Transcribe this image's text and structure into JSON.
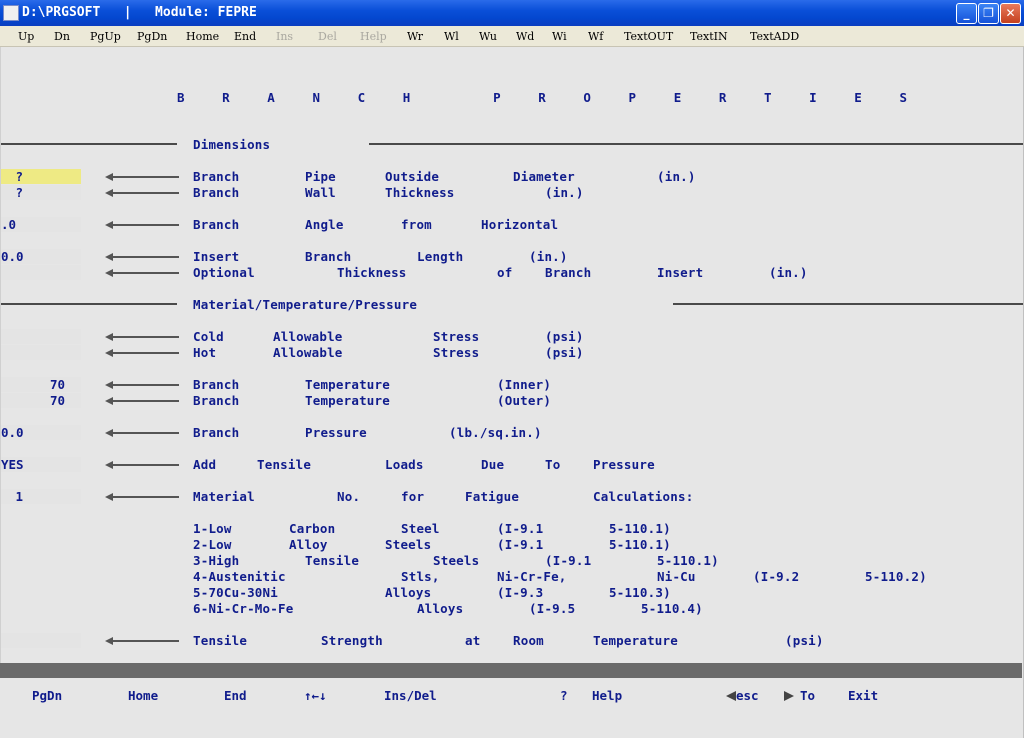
{
  "window": {
    "title": "D:\\PRGSOFT   |   Module: FEPRE",
    "buttons": {
      "minimize": "_",
      "maximize": "❐",
      "close": "✕"
    }
  },
  "menu": [
    {
      "label": "Up"
    },
    {
      "label": "Dn"
    },
    {
      "label": "PgUp"
    },
    {
      "label": "PgDn"
    },
    {
      "label": "Home"
    },
    {
      "label": "End"
    },
    {
      "label": "Ins"
    },
    {
      "label": "Del"
    },
    {
      "label": "Help"
    },
    {
      "label": "Wr"
    },
    {
      "label": "Wl"
    },
    {
      "label": "Wu"
    },
    {
      "label": "Wd"
    },
    {
      "label": "Wi"
    },
    {
      "label": "Wf"
    },
    {
      "label": "TextOUT"
    },
    {
      "label": "TextIN"
    },
    {
      "label": "TextADD"
    }
  ],
  "page": {
    "heading": "B     R     A     N     C     H           P     R     O     P     E     R     T     I     E     S",
    "section_dimensions": "Dimensions",
    "section_material": "Material/Temperature/Pressure",
    "row_pipe_od": {
      "value": "?",
      "c1": "Branch",
      "c2": "Pipe",
      "c3": "Outside",
      "c4": "Diameter",
      "c5": "(in.)"
    },
    "row_wall": {
      "value": "?",
      "c1": "Branch",
      "c2": "Wall",
      "c3": "Thickness",
      "c4": "(in.)"
    },
    "row_angle": {
      "value": ".0",
      "c1": "Branch",
      "c2": "Angle",
      "c3": "from",
      "c4": "Horizontal"
    },
    "row_insert_len": {
      "value": "0.0",
      "c1": "Insert",
      "c2": "Branch",
      "c3": "Length",
      "c4": "(in.)"
    },
    "row_insert_thk": {
      "value": "",
      "c1": "Optional",
      "c2": "Thickness",
      "c3": "of",
      "c4": "Branch",
      "c5": "Insert",
      "c6": "(in.)"
    },
    "row_cold": {
      "value": "",
      "c1": "Cold",
      "c2": "Allowable",
      "c3": "Stress",
      "c4": "(psi)"
    },
    "row_hot": {
      "value": "",
      "c1": "Hot",
      "c2": "Allowable",
      "c3": "Stress",
      "c4": "(psi)"
    },
    "row_temp_in": {
      "value": "70",
      "c1": "Branch",
      "c2": "Temperature",
      "c3": "(Inner)"
    },
    "row_temp_out": {
      "value": "70",
      "c1": "Branch",
      "c2": "Temperature",
      "c3": "(Outer)"
    },
    "row_pressure": {
      "value": "0.0",
      "c1": "Branch",
      "c2": "Pressure",
      "c3": "(lb./sq.in.)"
    },
    "row_tensile_add": {
      "value": "YES",
      "c1": "Add",
      "c2": "Tensile",
      "c3": "Loads",
      "c4": "Due",
      "c5": "To",
      "c6": "Pressure"
    },
    "row_material": {
      "value": "1",
      "c1": "Material",
      "c2": "No.",
      "c3": "for",
      "c4": "Fatigue",
      "c5": "Calculations:"
    },
    "materials": {
      "m1": {
        "a": "1-Low",
        "b": "Carbon",
        "c": "Steel",
        "d": "(I-9.1",
        "e": "5-110.1)"
      },
      "m2": {
        "a": "2-Low",
        "b": "Alloy",
        "c": "Steels",
        "d": "(I-9.1",
        "e": "5-110.1)"
      },
      "m3": {
        "a": "3-High",
        "b": "Tensile",
        "c": "Steels",
        "d": "(I-9.1",
        "e": "5-110.1)"
      },
      "m4": {
        "a": "4-Austenitic",
        "b": "Stls,",
        "c": "Ni-Cr-Fe,",
        "d": "Ni-Cu",
        "e": "(I-9.2",
        "f": "5-110.2)"
      },
      "m5": {
        "a": "5-70Cu-30Ni",
        "b": "Alloys",
        "c": "(I-9.3",
        "d": "5-110.3)"
      },
      "m6": {
        "a": "6-Ni-Cr-Mo-Fe",
        "b": "Alloys",
        "c": "(I-9.5",
        "d": "5-110.4)"
      }
    },
    "row_tensile_strength": {
      "value": "",
      "c1": "Tensile",
      "c2": "Strength",
      "c3": "at",
      "c4": "Room",
      "c5": "Temperature",
      "c6": "(psi)"
    }
  },
  "footer": {
    "pgdn": "PgDn",
    "home": "Home",
    "end": "End",
    "arrows": "↑←↓",
    "insdel": "Ins/Del",
    "q": "?",
    "help": "Help",
    "esc": "esc",
    "to": "To",
    "exit": "Exit"
  },
  "colors": {
    "text": "#101c8c",
    "active_field": "#eeea84",
    "titlebar": "#0a4fd8"
  }
}
